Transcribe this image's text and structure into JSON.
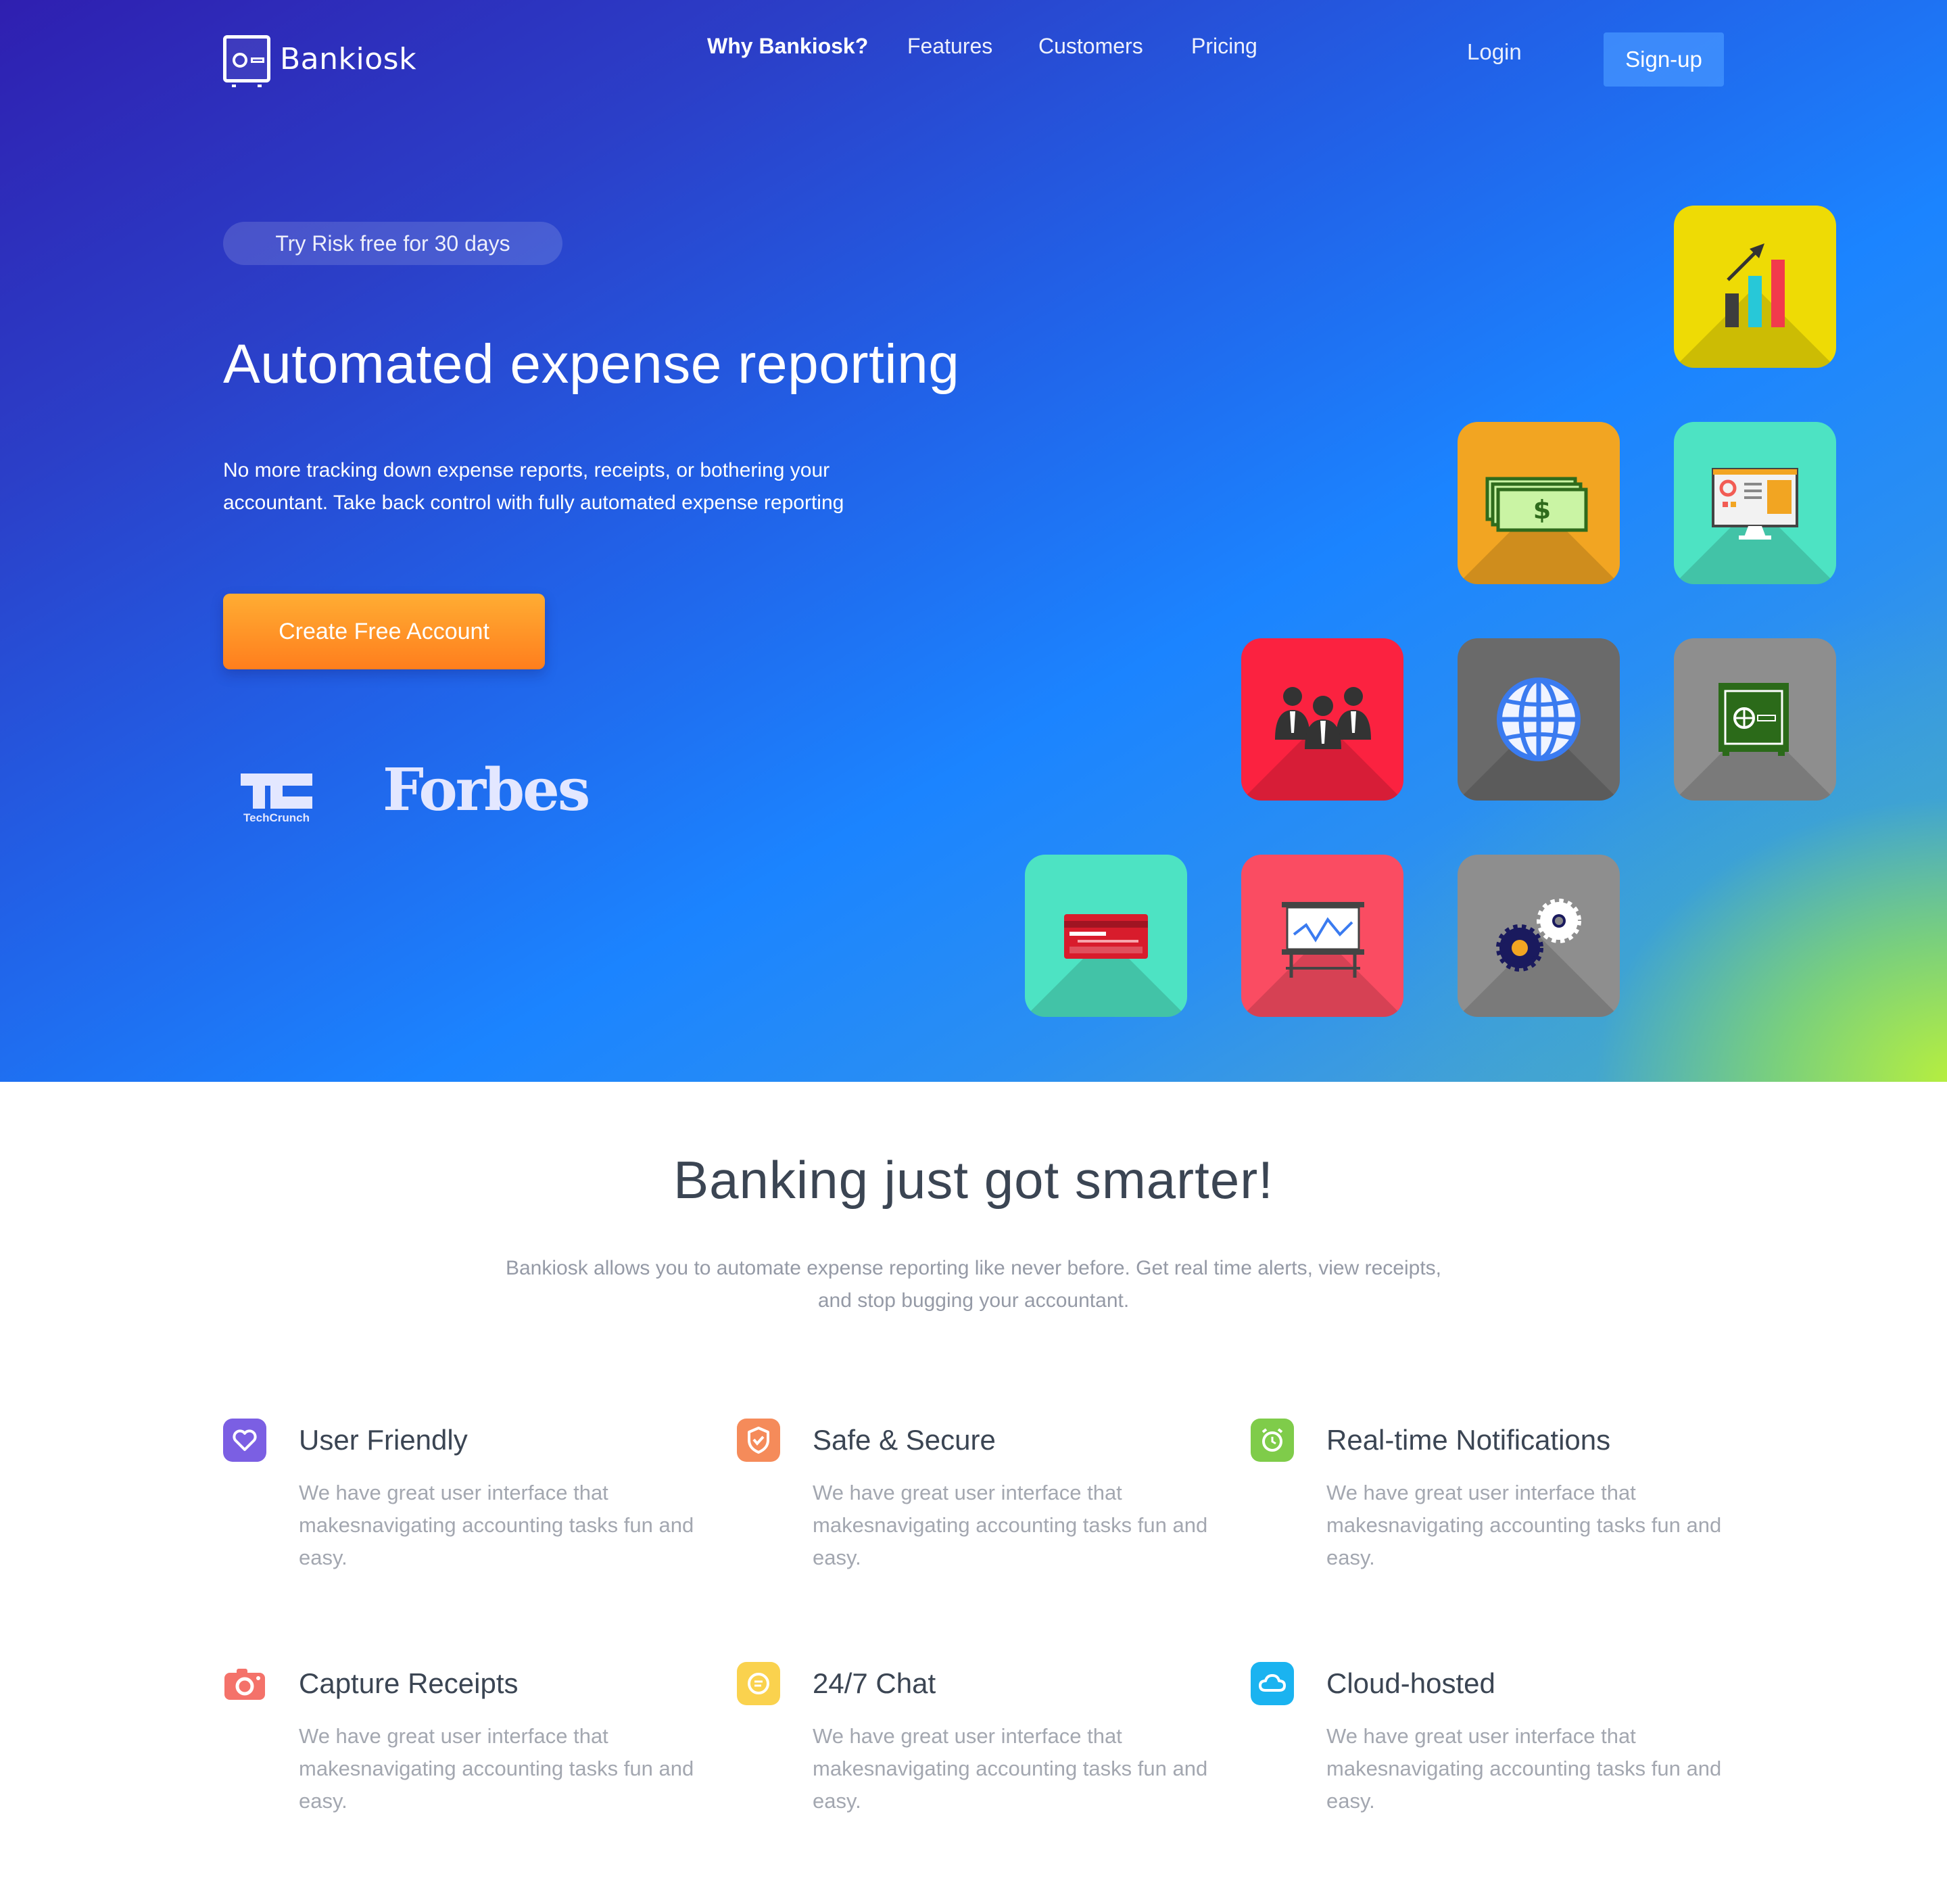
{
  "brand": {
    "name": "Bankiosk"
  },
  "nav": {
    "links": [
      "Why Bankiosk?",
      "Features",
      "Customers",
      "Pricing"
    ],
    "active": "Why Bankiosk?",
    "login": "Login",
    "signup": "Sign-up"
  },
  "hero": {
    "pill": "Try Risk free for 30 days",
    "title": "Automated expense reporting",
    "description": "No more tracking down expense reports, receipts, or bothering your accountant. Take back control with fully automated expense reporting",
    "cta": "Create Free Account",
    "press": {
      "techcrunch_caption": "TechCrunch",
      "forbes": "Forbes"
    },
    "icons": [
      "growth-chart-icon",
      "money-stack-icon",
      "monitor-dashboard-icon",
      "team-people-icon",
      "globe-icon",
      "safe-vault-icon",
      "credit-card-icon",
      "presentation-board-icon",
      "gears-icon"
    ]
  },
  "section": {
    "title": "Banking just got smarter!",
    "subtitle": "Bankiosk allows you to automate expense reporting like never before. Get real time alerts, view receipts, and stop bugging your accountant."
  },
  "features": [
    {
      "title": "User Friendly",
      "description": "We have great user interface that makesnavigating accounting tasks fun and easy.",
      "icon": "heart-icon",
      "color": "#7b5fe3"
    },
    {
      "title": "Safe & Secure",
      "description": "We have great user interface that makesnavigating accounting tasks fun and easy.",
      "icon": "shield-icon",
      "color": "#f58b5a"
    },
    {
      "title": "Real-time Notifications",
      "description": "We have great user interface that makesnavigating accounting tasks fun and easy.",
      "icon": "alarm-clock-icon",
      "color": "#7fcc4a"
    },
    {
      "title": "Capture Receipts",
      "description": "We have great user interface that makesnavigating accounting tasks fun and easy.",
      "icon": "camera-icon",
      "color": "#f4726a"
    },
    {
      "title": "24/7 Chat",
      "description": "We have great user interface that makesnavigating accounting tasks fun and easy.",
      "icon": "chat-bubble-icon",
      "color": "#fad24e"
    },
    {
      "title": "Cloud-hosted",
      "description": "We have great user interface that makesnavigating accounting tasks fun and easy.",
      "icon": "cloud-icon",
      "color": "#1ab3f0"
    }
  ]
}
